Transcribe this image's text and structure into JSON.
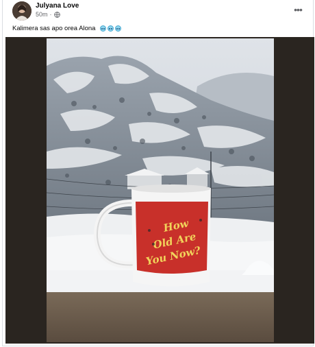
{
  "post": {
    "author": "Julyana Love",
    "time": "50m",
    "separator": "·",
    "caption": "Kalimera sas apo orea Alona",
    "caption_emoji": [
      "cold-face-emoji",
      "cold-face-emoji",
      "cold-face-emoji"
    ],
    "more_icon": "more-dots-icon",
    "privacy_icon": "globe-icon"
  },
  "photo": {
    "mug_text": [
      "How",
      "Old Are",
      "You Now?"
    ],
    "colors": {
      "mug_red": "#c8302a",
      "snow": "#eef0f2",
      "sky": "#cdd3db"
    }
  }
}
